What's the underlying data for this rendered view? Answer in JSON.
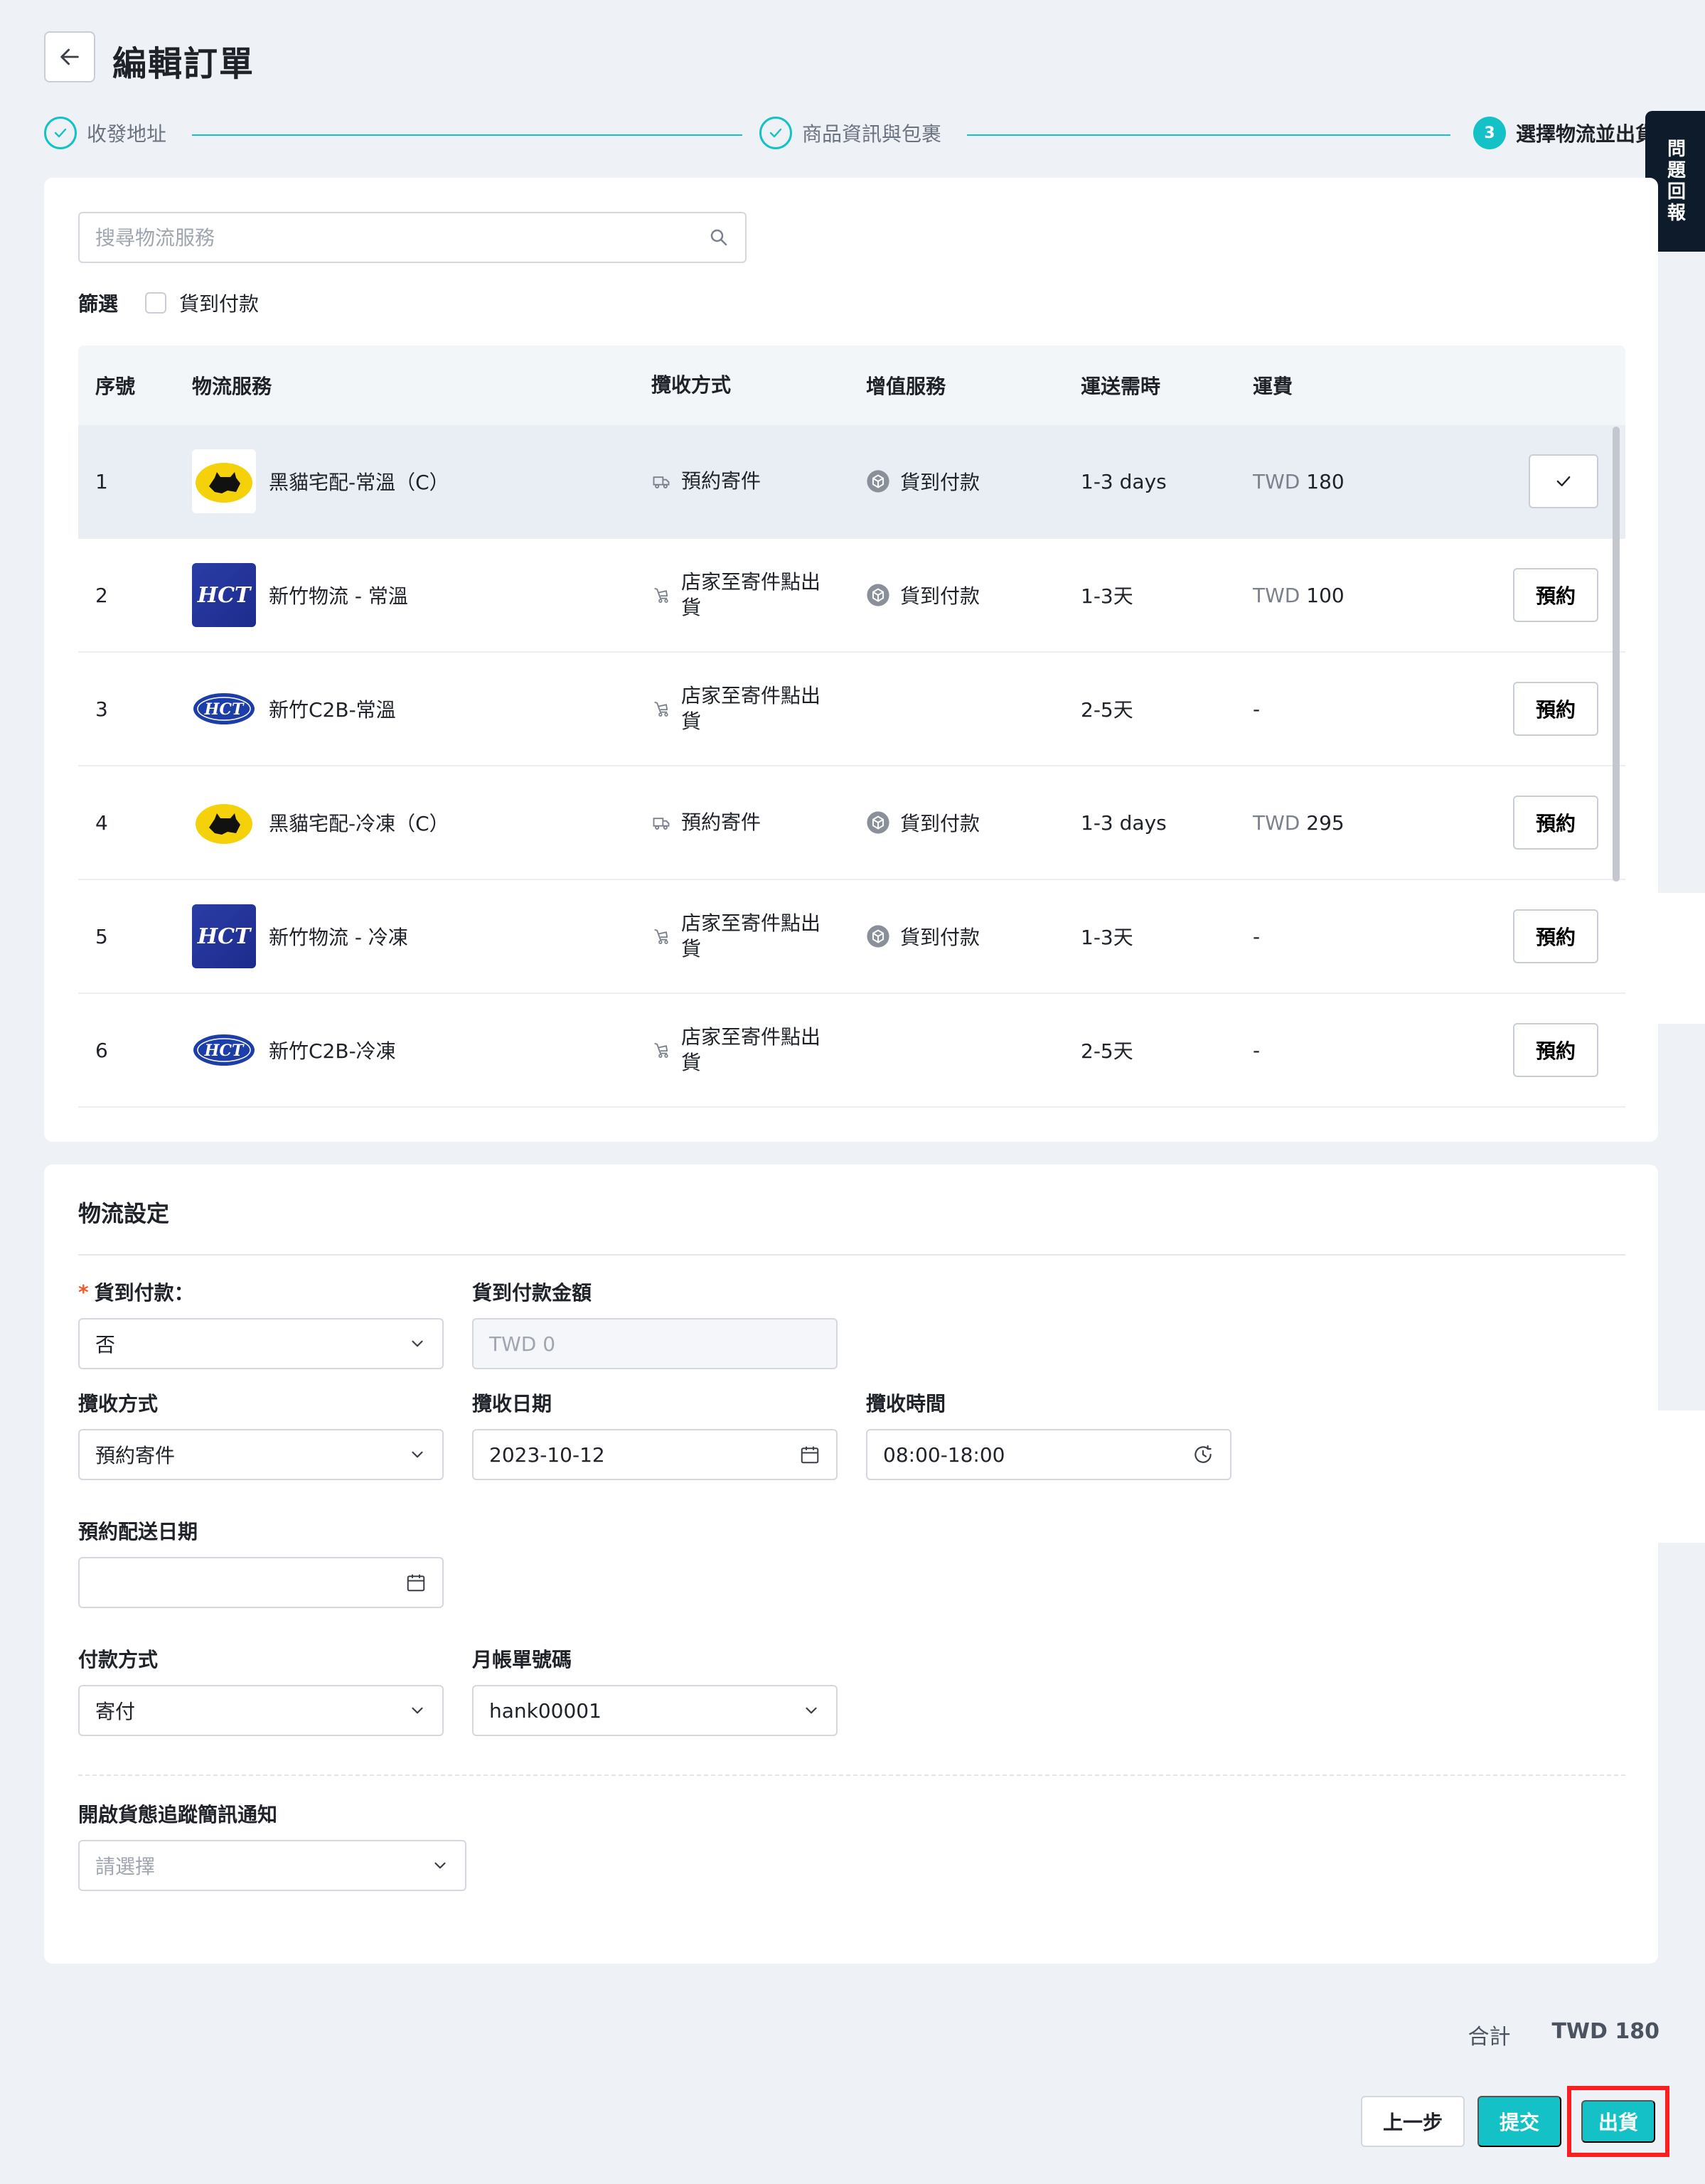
{
  "header": {
    "title": "編輯訂單"
  },
  "steps": [
    {
      "label": "收發地址",
      "state": "done"
    },
    {
      "label": "商品資訊與包裹",
      "state": "done"
    },
    {
      "number": "3",
      "label": "選擇物流並出貨",
      "state": "active"
    }
  ],
  "feedback": {
    "label": "問題回報"
  },
  "search": {
    "placeholder": "搜尋物流服務"
  },
  "filter": {
    "label": "篩選",
    "cod_option": "貨到付款"
  },
  "table": {
    "headers": {
      "no": "序號",
      "service": "物流服務",
      "pickup": "攬收方式",
      "value_added": "增值服務",
      "delivery_time": "運送需時",
      "fee": "運費"
    },
    "rows": [
      {
        "no": "1",
        "service": "黑貓宅配-常溫（C）",
        "logo": "black-cat",
        "pickup": "預約寄件",
        "pickup_icon": "truck-icon",
        "value_added": "貨到付款",
        "time": "1-3 days",
        "fee_currency": "TWD",
        "fee_amount": "180",
        "selected": true,
        "action": ""
      },
      {
        "no": "2",
        "service": "新竹物流 - 常溫",
        "logo": "hct-square",
        "pickup": "店家至寄件點出貨",
        "pickup_icon": "cart-icon",
        "value_added": "貨到付款",
        "time": "1-3天",
        "fee_currency": "TWD",
        "fee_amount": "100",
        "selected": false,
        "action": "預約"
      },
      {
        "no": "3",
        "service": "新竹C2B-常溫",
        "logo": "hct-oval",
        "pickup": "店家至寄件點出貨",
        "pickup_icon": "cart-icon",
        "value_added": "",
        "time": "2-5天",
        "fee_currency": "",
        "fee_amount": "-",
        "selected": false,
        "action": "預約"
      },
      {
        "no": "4",
        "service": "黑貓宅配-冷凍（C）",
        "logo": "black-cat-round",
        "pickup": "預約寄件",
        "pickup_icon": "truck-icon",
        "value_added": "貨到付款",
        "time": "1-3 days",
        "fee_currency": "TWD",
        "fee_amount": "295",
        "selected": false,
        "action": "預約"
      },
      {
        "no": "5",
        "service": "新竹物流 - 冷凍",
        "logo": "hct-square",
        "pickup": "店家至寄件點出貨",
        "pickup_icon": "cart-icon",
        "value_added": "貨到付款",
        "time": "1-3天",
        "fee_currency": "",
        "fee_amount": "-",
        "selected": false,
        "action": "預約"
      },
      {
        "no": "6",
        "service": "新竹C2B-冷凍",
        "logo": "hct-oval",
        "pickup": "店家至寄件點出貨",
        "pickup_icon": "cart-icon",
        "value_added": "",
        "time": "2-5天",
        "fee_currency": "",
        "fee_amount": "-",
        "selected": false,
        "action": "預約"
      }
    ]
  },
  "settings": {
    "title": "物流設定",
    "cod": {
      "label": "貨到付款：",
      "value": "否"
    },
    "cod_amount": {
      "label": "貨到付款金額",
      "value": "TWD 0"
    },
    "pickup_method": {
      "label": "攬收方式",
      "value": "預約寄件"
    },
    "pickup_date": {
      "label": "攬收日期",
      "value": "2023-10-12"
    },
    "pickup_time": {
      "label": "攬收時間",
      "value": "08:00-18:00"
    },
    "delivery_date": {
      "label": "預約配送日期",
      "value": ""
    },
    "payment_method": {
      "label": "付款方式",
      "value": "寄付"
    },
    "monthly_account": {
      "label": "月帳單號碼",
      "value": "hank00001"
    },
    "sms": {
      "label": "開啟貨態追蹤簡訊通知",
      "placeholder": "請選擇"
    }
  },
  "summary": {
    "label": "合計",
    "value": "TWD 180"
  },
  "footer": {
    "prev": "上一步",
    "submit": "提交",
    "ship": "出貨"
  },
  "colors": {
    "accent": "#14c1c6",
    "highlight_border": "#ff1e1e",
    "feedback_bg": "#0d1b2a"
  }
}
